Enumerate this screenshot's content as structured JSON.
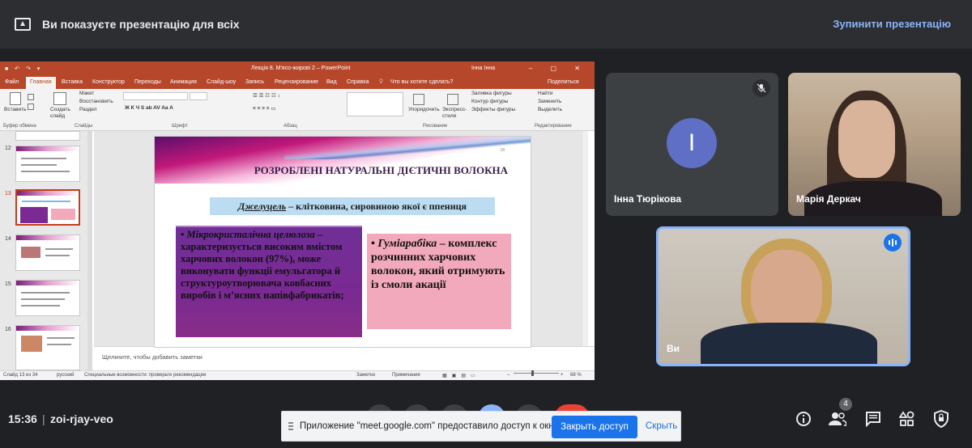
{
  "banner": {
    "message": "Ви показуєте презентацію для всіх",
    "stop_label": "Зупинити презентацію"
  },
  "powerpoint": {
    "window_title": "Лекція 8. М'ясо-жирові 2  –  PowerPoint",
    "user": "Інна Інна",
    "tabs": [
      "Файл",
      "Главная",
      "Вставка",
      "Конструктор",
      "Переходы",
      "Анимация",
      "Слайд-шоу",
      "Запись",
      "Рецензирование",
      "Вид",
      "Справка"
    ],
    "tell_me": "Что вы хотите сделать?",
    "share": "Поделиться",
    "ribbon": {
      "paste": "Вставить",
      "create_slide": "Создать слайд",
      "layout": "Макет",
      "restore": "Восстановить",
      "section": "Раздел",
      "arrange": "Упорядочить",
      "express_styles": "Экспресс-стили",
      "fill": "Заливка фигуры",
      "outline": "Контур фигуры",
      "effects": "Эффекты фигуры",
      "find": "Найти",
      "replace": "Заменить",
      "select": "Выделить",
      "groups": [
        "Буфер обмена",
        "Слайды",
        "Шрифт",
        "Абзац",
        "Рисование",
        "Редактирование"
      ]
    },
    "thumbnail_numbers": [
      "12",
      "13",
      "14",
      "15",
      "16"
    ],
    "slide": {
      "number": "18",
      "title": "РОЗРОБЛЕНІ НАТУРАЛЬНІ ДІЄТИЧНІ ВОЛОКНА",
      "subtitle_em": "Джелуцель",
      "subtitle_rest": " – клітковина, сировиною якої є ппениця",
      "left_em": "Мікрокристалічна целюлоза",
      "left_rest": " – характеризується високим вмістом харчових волокон (97%), може виконувати функції емульгатора й структуроутворювача ковбасних виробів і м’ясних напівфабрикатів;",
      "right_em": "Гуміарабіка",
      "right_rest": " – комплекс розчинних харчових волокон, який отримують із смоли акації"
    },
    "notes_placeholder": "Щелкните, чтобы добавить заметки",
    "status": {
      "slide_of": "Слайд 13 из 34",
      "language": "русский",
      "accessibility": "Специальные возможности: проверьте рекомендации",
      "notes": "Заметки",
      "comments": "Примечания",
      "zoom": "68 %"
    }
  },
  "participants": [
    {
      "name": "Інна Тюрікова",
      "initial": "І",
      "avatar_color": "#5f6fc6",
      "muted": true
    },
    {
      "name": "Марія Деркач"
    },
    {
      "name": "Ви",
      "speaking": true
    }
  ],
  "bottom_bar": {
    "time": "15:36",
    "separator": "|",
    "meeting_code": "zoi-rjay-veo",
    "people_count": "4"
  },
  "notification": {
    "text": "Приложение \"meet.google.com\" предоставило доступ к окну.",
    "close_access": "Закрыть доступ",
    "hide": "Скрыть"
  },
  "colors": {
    "accent": "#8ab4f8",
    "primary_button": "#1a73e8",
    "ppt_brand": "#b7472a",
    "background": "#202124"
  }
}
